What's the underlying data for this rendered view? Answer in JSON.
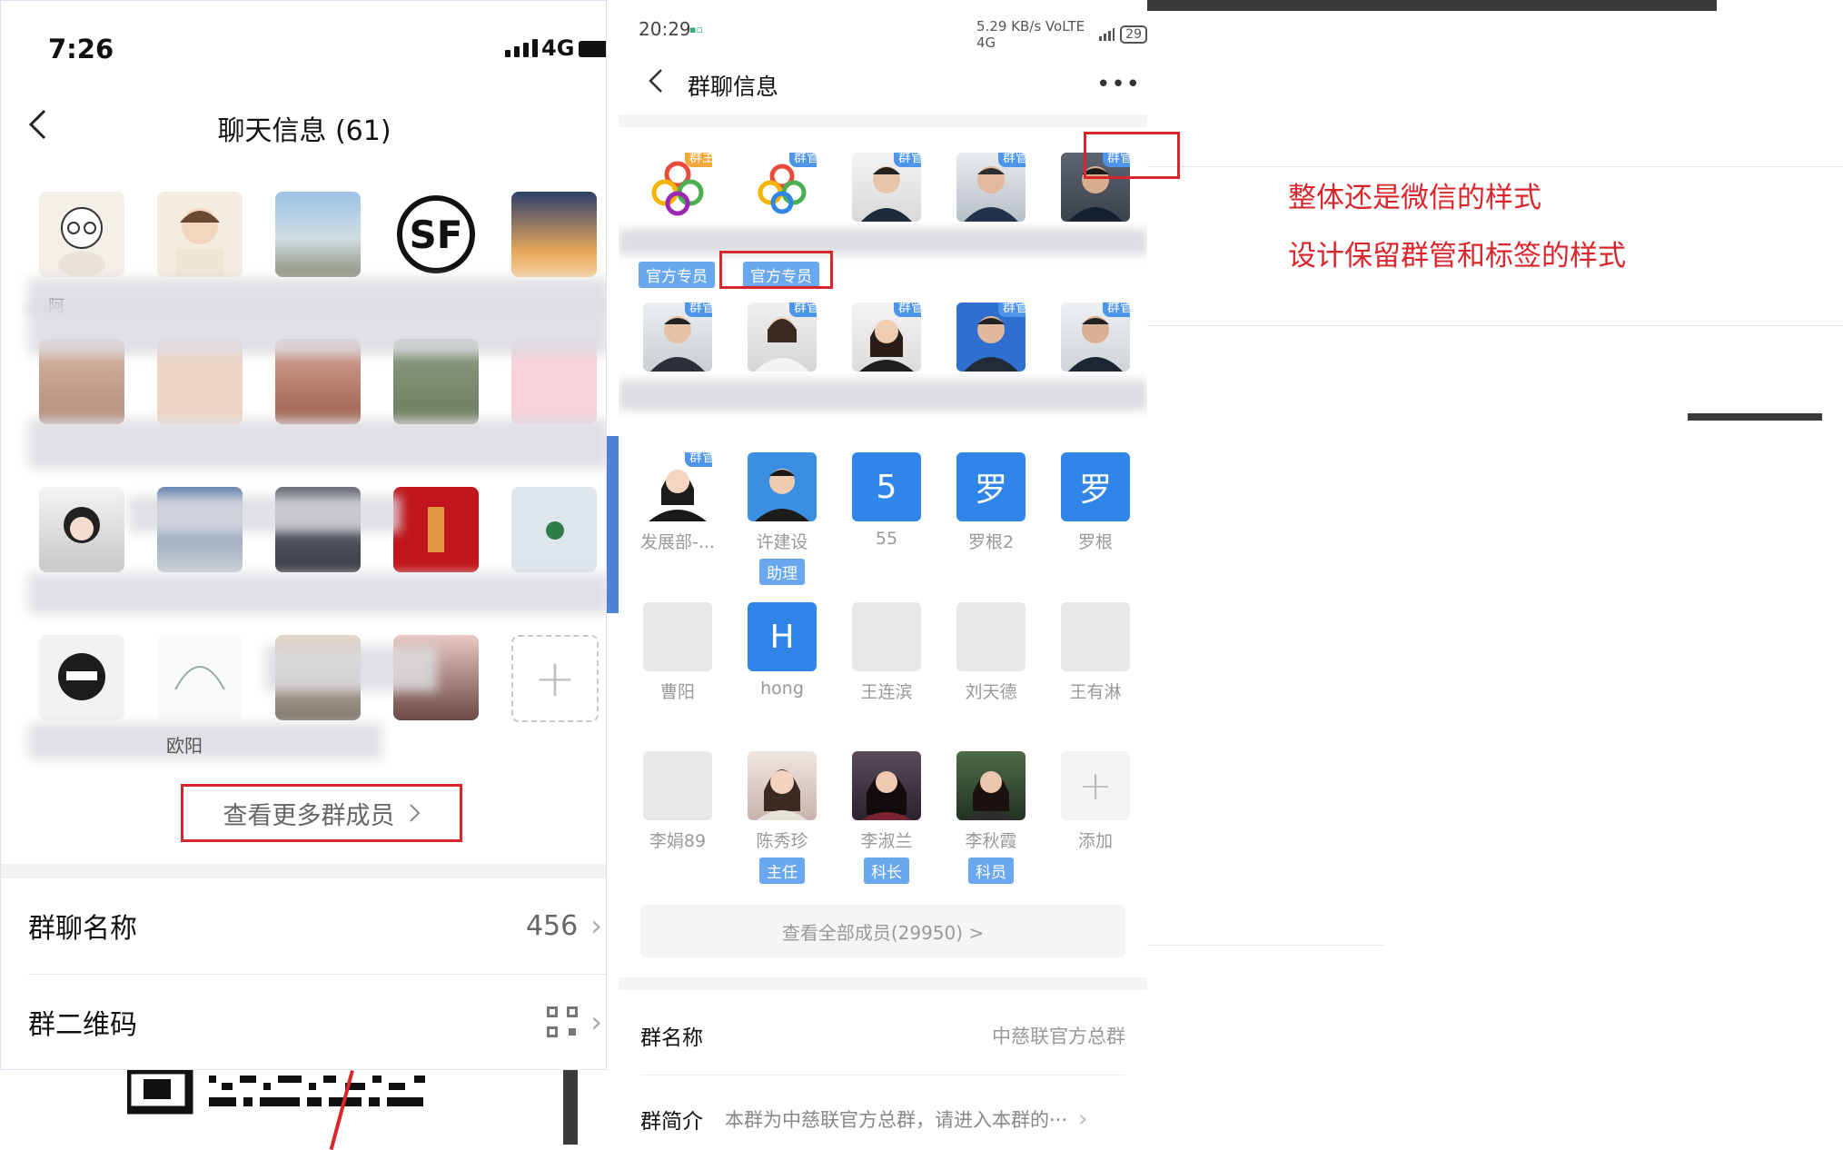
{
  "left_phone": {
    "status": {
      "time": "7:26",
      "network": "4G"
    },
    "title": "聊天信息 (61)",
    "more_members_label": "查看更多群成员",
    "rows": [
      {
        "label": "群聊名称",
        "value": "456"
      },
      {
        "label": "群二维码",
        "value": ""
      }
    ],
    "visible_fragment": "欧阳"
  },
  "right_phone": {
    "status": {
      "time": "20:29",
      "indicators": "5.29 KB/s  VoLTE 4G",
      "battery": "29"
    },
    "title": "群聊信息",
    "members": [
      {
        "name": "",
        "badge": "群主",
        "tag": "官方专员",
        "avatar": "logo"
      },
      {
        "name": "",
        "badge": "群管",
        "tag": "官方专员",
        "avatar": "logo"
      },
      {
        "name": "",
        "badge": "群管",
        "tag": "",
        "avatar": "photo"
      },
      {
        "name": "",
        "badge": "群管",
        "tag": "",
        "avatar": "photo"
      },
      {
        "name": "",
        "badge": "群管",
        "tag": "",
        "avatar": "photo"
      },
      {
        "name": "",
        "badge": "群管",
        "tag": "",
        "avatar": "photo"
      },
      {
        "name": "",
        "badge": "群管",
        "tag": "",
        "avatar": "photo"
      },
      {
        "name": "",
        "badge": "群管",
        "tag": "",
        "avatar": "photo"
      },
      {
        "name": "",
        "badge": "群管",
        "tag": "",
        "avatar": "photo"
      },
      {
        "name": "",
        "badge": "群管",
        "tag": "",
        "avatar": "photo"
      },
      {
        "name": "发展部-...",
        "badge": "群管",
        "tag": "",
        "avatar": "photo"
      },
      {
        "name": "许建设",
        "badge": "",
        "tag": "助理",
        "avatar": "photo"
      },
      {
        "name": "55",
        "badge": "",
        "tag": "",
        "avatar": "letter",
        "letter": "5"
      },
      {
        "name": "罗根2",
        "badge": "",
        "tag": "",
        "avatar": "letter",
        "letter": "罗"
      },
      {
        "name": "罗根",
        "badge": "",
        "tag": "",
        "avatar": "letter",
        "letter": "罗"
      },
      {
        "name": "曹阳",
        "badge": "",
        "tag": "",
        "avatar": "gray"
      },
      {
        "name": "hong",
        "badge": "",
        "tag": "",
        "avatar": "letter",
        "letter": "H"
      },
      {
        "name": "王连滨",
        "badge": "",
        "tag": "",
        "avatar": "gray"
      },
      {
        "name": "刘天德",
        "badge": "",
        "tag": "",
        "avatar": "gray"
      },
      {
        "name": "王有淋",
        "badge": "",
        "tag": "",
        "avatar": "gray"
      },
      {
        "name": "李娟89",
        "badge": "",
        "tag": "",
        "avatar": "gray"
      },
      {
        "name": "陈秀珍",
        "badge": "",
        "tag": "主任",
        "avatar": "photo"
      },
      {
        "name": "李淑兰",
        "badge": "",
        "tag": "科长",
        "avatar": "photo"
      },
      {
        "name": "李秋霞",
        "badge": "",
        "tag": "科员",
        "avatar": "photo"
      },
      {
        "name": "添加",
        "badge": "",
        "tag": "",
        "avatar": "add"
      }
    ],
    "view_all": "查看全部成员(29950) >",
    "group_name_label": "群名称",
    "group_name_value": "中慈联官方总群",
    "group_intro_label": "群简介",
    "group_intro_value": "本群为中慈联官方总群，请进入本群的···"
  },
  "annotations": {
    "line1": "整体还是微信的样式",
    "line2": "设计保留群管和标签的样式"
  }
}
